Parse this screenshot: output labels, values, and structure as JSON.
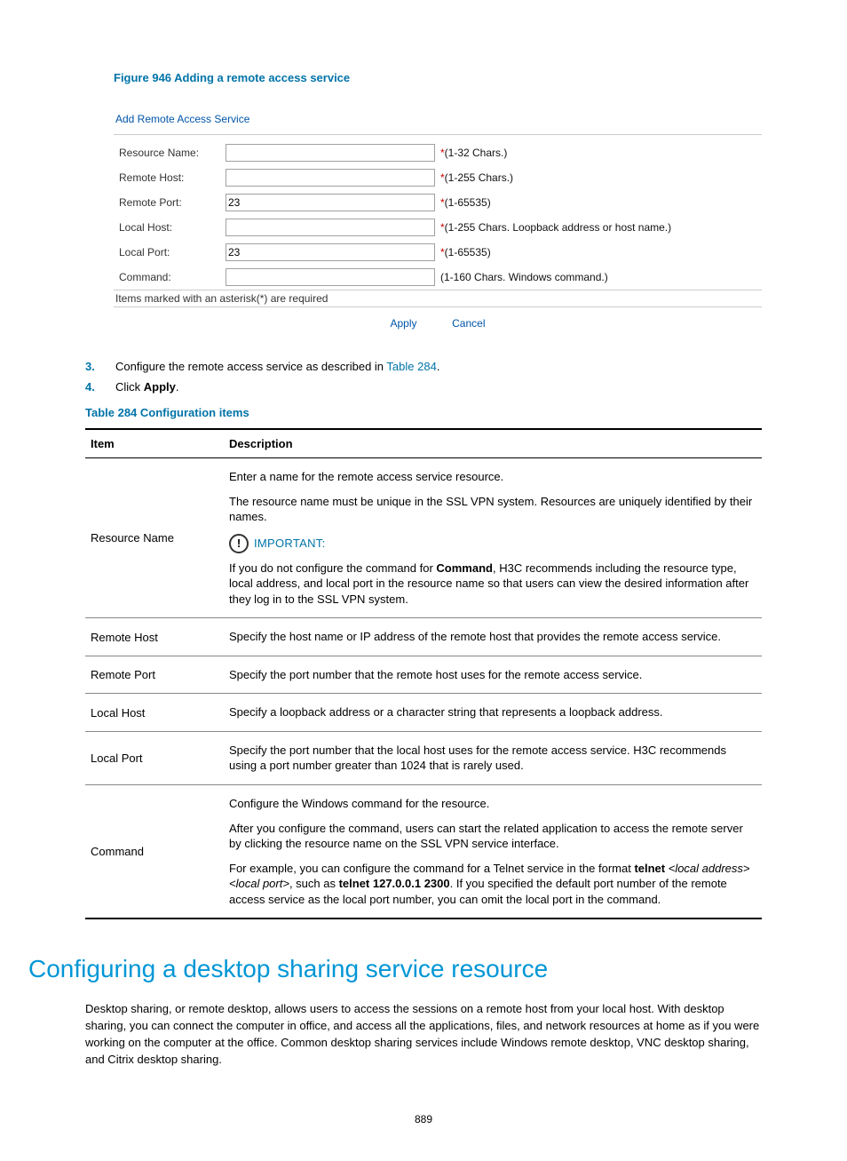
{
  "figureCaption": "Figure 946 Adding a remote access service",
  "form": {
    "title": "Add Remote Access Service",
    "rows": [
      {
        "label": "Resource Name:",
        "value": "",
        "hint": "(1-32 Chars.)",
        "star": true
      },
      {
        "label": "Remote Host:",
        "value": "",
        "hint": "(1-255 Chars.)",
        "star": true
      },
      {
        "label": "Remote Port:",
        "value": "23",
        "hint": "(1-65535)",
        "star": true
      },
      {
        "label": "Local Host:",
        "value": "",
        "hint": "(1-255 Chars. Loopback address or host name.)",
        "star": true
      },
      {
        "label": "Local Port:",
        "value": "23",
        "hint": "(1-65535)",
        "star": true
      },
      {
        "label": "Command:",
        "value": "",
        "hint": "(1-160 Chars. Windows command.)",
        "star": false
      }
    ],
    "requiredNote": "Items marked with an asterisk(*) are required",
    "apply": "Apply",
    "cancel": "Cancel"
  },
  "steps": [
    {
      "num": "3.",
      "pre": "Configure the remote access service as described in ",
      "link": "Table 284",
      "post": "."
    },
    {
      "num": "4.",
      "pre": "Click ",
      "bold": "Apply",
      "post": "."
    }
  ],
  "tableCaption": "Table 284 Configuration items",
  "tableHead": {
    "c1": "Item",
    "c2": "Description"
  },
  "tableRows": {
    "r0": {
      "item": "Resource Name",
      "p1": "Enter a name for the remote access service resource.",
      "p2": "The resource name must be unique in the SSL VPN system. Resources are uniquely identified by their names.",
      "importantLabel": "IMPORTANT:",
      "p3a": "If you do not configure the command for ",
      "p3bold": "Command",
      "p3b": ", H3C recommends including the resource type, local address, and local port in the resource name so that users can view the desired information after they log in to the SSL VPN system."
    },
    "r1": {
      "item": "Remote Host",
      "p1": "Specify the host name or IP address of the remote host that provides the remote access service."
    },
    "r2": {
      "item": "Remote Port",
      "p1": "Specify the port number that the remote host uses for the remote access service."
    },
    "r3": {
      "item": "Local Host",
      "p1": "Specify a loopback address or a character string that represents a loopback address."
    },
    "r4": {
      "item": "Local Port",
      "p1": "Specify the port number that the local host uses for the remote access service. H3C recommends using a port number greater than 1024 that is rarely used."
    },
    "r5": {
      "item": "Command",
      "p1": "Configure the Windows command for the resource.",
      "p2": "After you configure the command, users can start the related application to access the remote server by clicking the resource name on the SSL VPN service interface.",
      "p3a": "For example, you can configure the command for a Telnet service in the format ",
      "p3b1": "telnet",
      "p3b2": " <local address> <local port>",
      "p3c": ", such as ",
      "p3b3": "telnet 127.0.0.1 2300",
      "p3d": ". If you specified the default port number of the remote access service as the local port number, you can omit the local port in the command."
    }
  },
  "section": {
    "title": "Configuring a desktop sharing service resource",
    "body": "Desktop sharing, or remote desktop, allows users to access the sessions on a remote host from your local host. With desktop sharing, you can connect the computer in office, and access all the applications, files, and network resources at home as if you were working on the computer at the office. Common desktop sharing services include Windows remote desktop, VNC desktop sharing, and Citrix desktop sharing."
  },
  "pageNumber": "889"
}
